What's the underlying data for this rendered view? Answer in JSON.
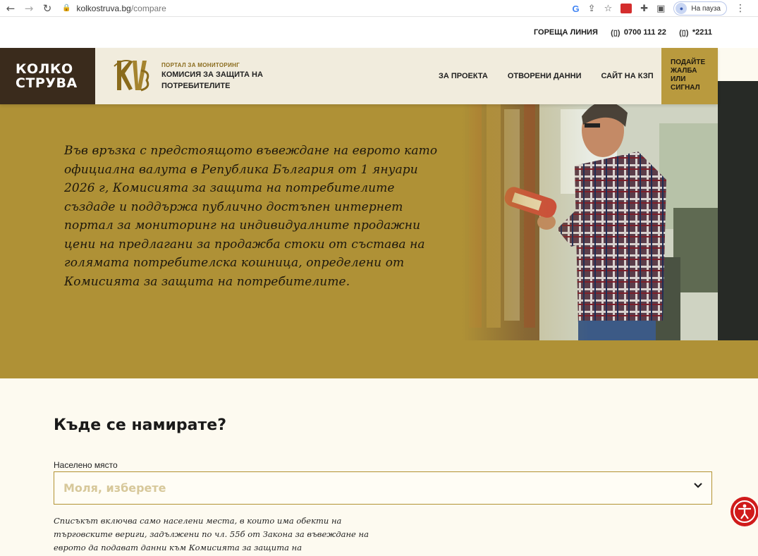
{
  "browser": {
    "url_domain": "kolkostruva.bg",
    "url_path": "/compare",
    "profile_label": "На пауза"
  },
  "hotline": {
    "label": "ГОРЕЩА ЛИНИЯ",
    "phone1": "0700 111 22",
    "phone2": "*2211"
  },
  "header": {
    "logo_line1": "КОЛКО",
    "logo_line2": "СТРУВА",
    "portal_small": "ПОРТАЛ ЗА МОНИТОРИНГ",
    "commission_line1": "КОМИСИЯ ЗА ЗАЩИТА НА",
    "commission_line2": "ПОТРЕБИТЕЛИТЕ",
    "nav": [
      {
        "label": "ЗА ПРОЕКТА"
      },
      {
        "label": "ОТВОРЕНИ ДАННИ"
      },
      {
        "label": "САЙТ НА КЗП"
      }
    ],
    "complaint_lines": [
      "ПОДАЙТЕ",
      "ЖАЛБА",
      "ИЛИ",
      "СИГНАЛ"
    ]
  },
  "hero": {
    "text": "Във връзка с предстоящото въвеждане на еврото като официална валута в Република България от 1 януари 2026 г, Комисията за защита на потребителите създаде и поддържа публично достъпен интернет портал за мониторинг на индивидуалните продажни цени на предлагани за продажба стоки от състава на голямата потребителска кошница, определени от Комисията за защита на потребителите."
  },
  "location": {
    "title": "Къде се намирате?",
    "field_label": "Населено място",
    "placeholder": "Моля, изберете",
    "note": "Списъкът включва само населени места, в които има обекти на търговските вериги, задължени по чл. 55б от Закона за въвеждане на еврото да подават данни към Комисията за защита на потребителите."
  },
  "colors": {
    "gold": "#af9136",
    "header_bg": "#f1ecdd",
    "logo_bg": "#3a2b1c",
    "accessibility_red": "#d01b1b"
  },
  "icons": {
    "back": "arrow-left-icon",
    "forward": "arrow-right-icon",
    "reload": "reload-icon",
    "lock": "lock-icon",
    "chevron": "chevron-down-icon",
    "accessibility": "accessibility-icon"
  }
}
